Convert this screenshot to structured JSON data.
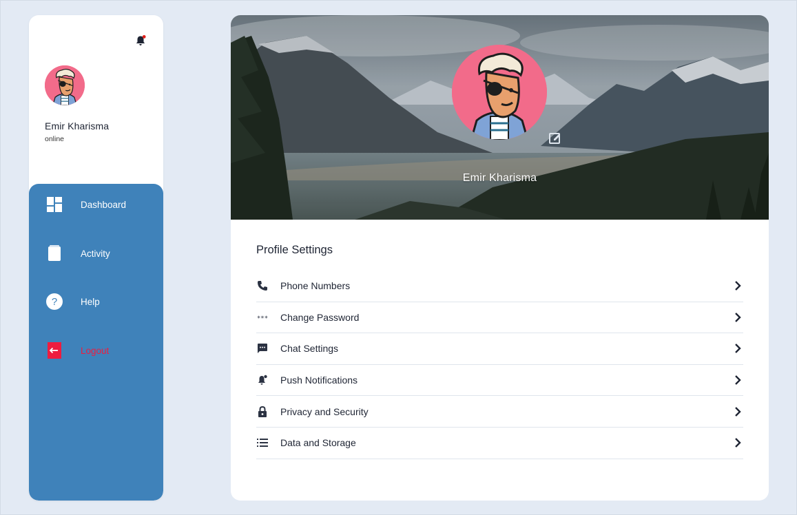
{
  "user": {
    "name": "Emir Kharisma",
    "status": "online"
  },
  "sidebar": {
    "items": [
      {
        "label": "Dashboard",
        "icon": "dashboard-icon"
      },
      {
        "label": "Activity",
        "icon": "book-icon"
      },
      {
        "label": "Help",
        "icon": "help-icon"
      },
      {
        "label": "Logout",
        "icon": "logout-icon"
      }
    ]
  },
  "profile": {
    "banner_name": "Emir Kharisma",
    "settings_title": "Profile Settings",
    "items": [
      {
        "label": "Phone Numbers",
        "icon": "phone-icon"
      },
      {
        "label": "Change Password",
        "icon": "password-icon"
      },
      {
        "label": "Chat Settings",
        "icon": "chat-icon"
      },
      {
        "label": "Push Notifications",
        "icon": "bell-icon"
      },
      {
        "label": "Privacy and Security",
        "icon": "lock-icon"
      },
      {
        "label": "Data and Storage",
        "icon": "list-icon"
      }
    ]
  },
  "colors": {
    "page_bg": "#e3eaf4",
    "sidebar_nav": "#3f82ba",
    "logout": "#ee1c3f",
    "avatar_bg": "#f26b8a",
    "notification_dot": "#e0201b"
  }
}
